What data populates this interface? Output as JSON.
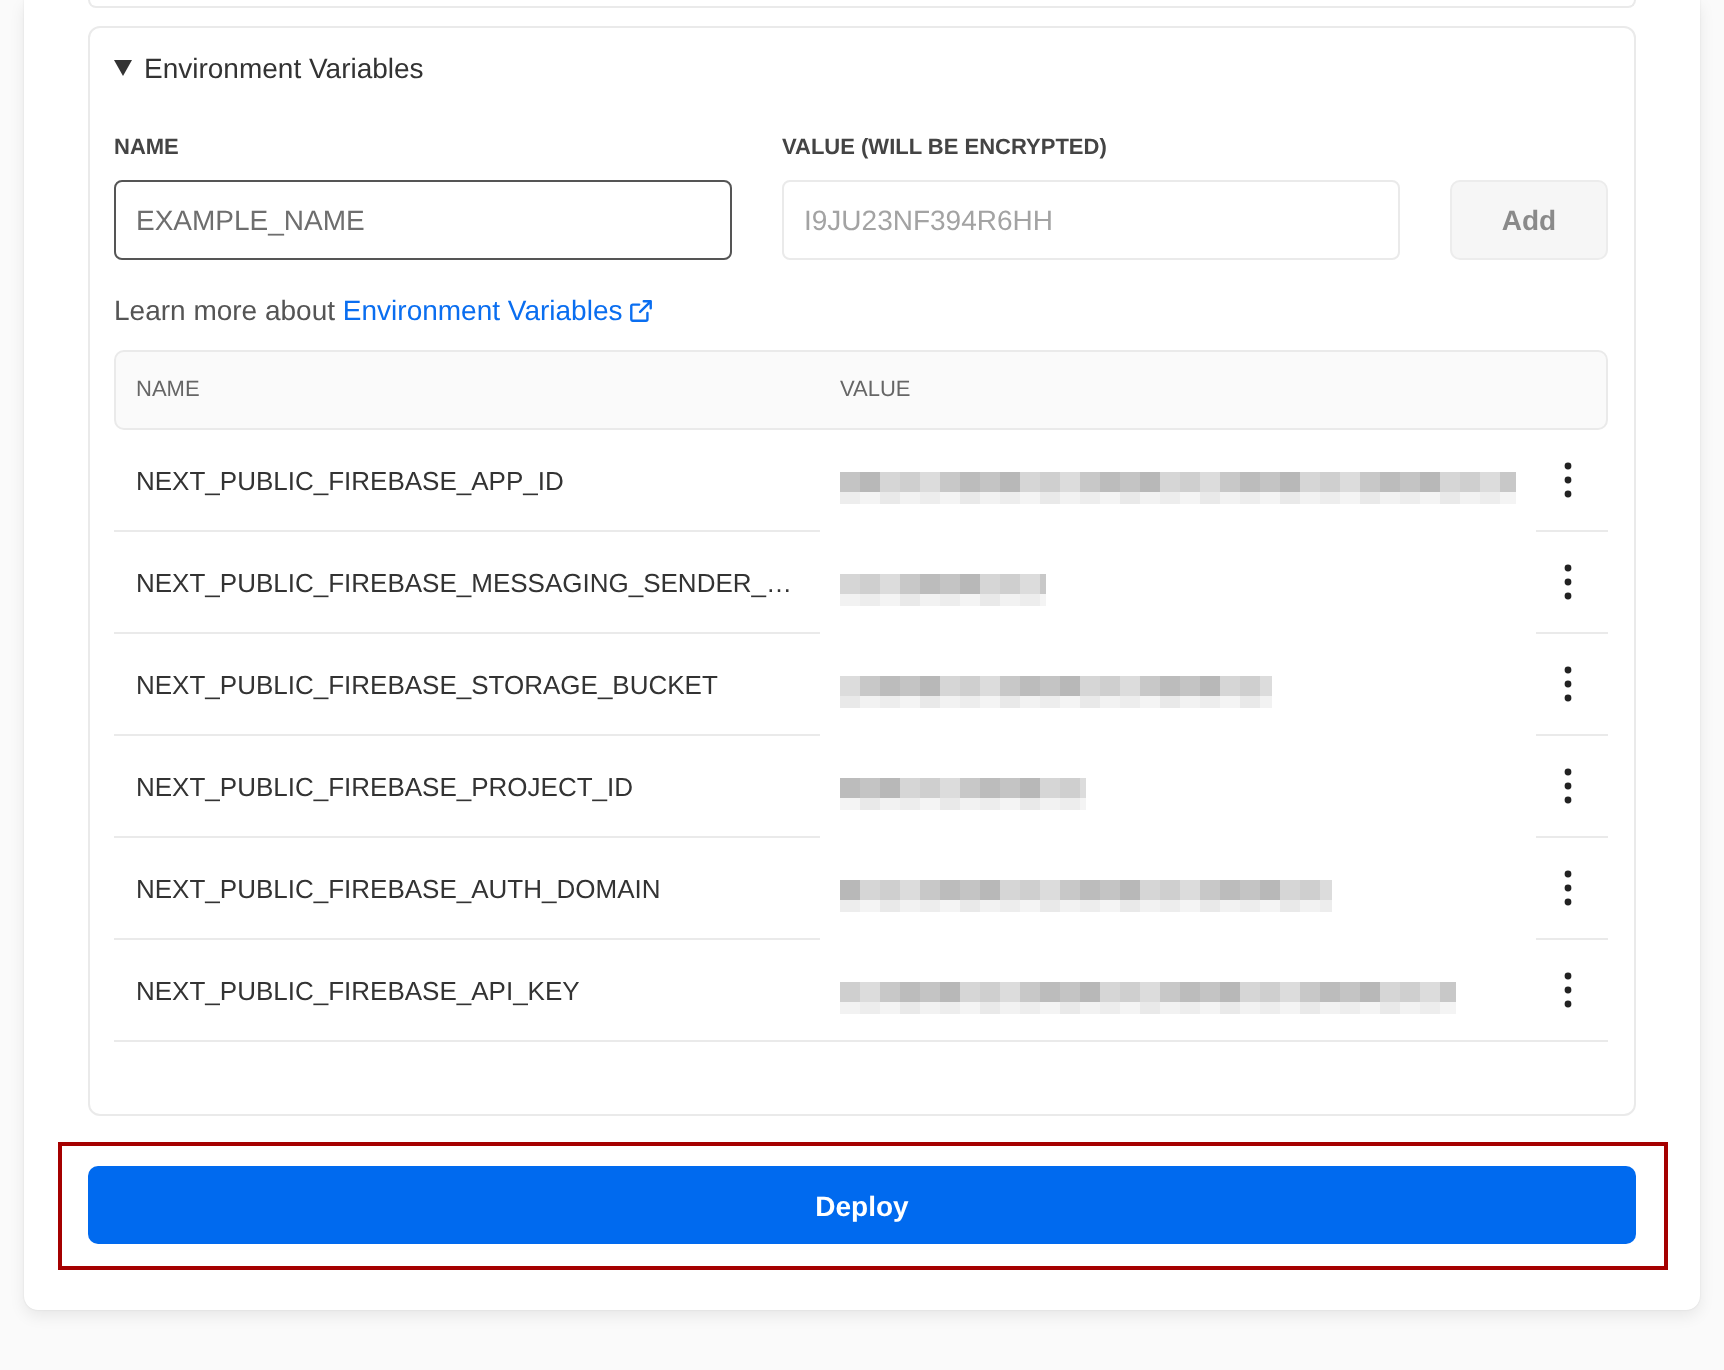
{
  "env_section": {
    "title": "Environment Variables",
    "expanded": true,
    "form": {
      "name_label": "NAME",
      "name_field": {
        "placeholder": "EXAMPLE_NAME",
        "focused": true
      },
      "value_label": "VALUE (WILL BE ENCRYPTED)",
      "value_field": {
        "placeholder": "I9JU23NF394R6HH",
        "focused": false
      },
      "add_button": {
        "label": "Add",
        "disabled": true
      }
    },
    "learn_more": {
      "text": "Learn more about",
      "link": "Environment Variables"
    },
    "table": {
      "columns": [
        "NAME",
        "VALUE"
      ],
      "rows": [
        {
          "name": "NEXT_PUBLIC_FIREBASE_APP_ID"
        },
        {
          "name": "NEXT_PUBLIC_FIREBASE_MESSAGING_SENDER_…"
        },
        {
          "name": "NEXT_PUBLIC_FIREBASE_STORAGE_BUCKET"
        },
        {
          "name": "NEXT_PUBLIC_FIREBASE_PROJECT_ID"
        },
        {
          "name": "NEXT_PUBLIC_FIREBASE_AUTH_DOMAIN"
        },
        {
          "name": "NEXT_PUBLIC_FIREBASE_API_KEY"
        }
      ]
    }
  },
  "deploy_button": {
    "label": "Deploy",
    "highlighted": true
  }
}
